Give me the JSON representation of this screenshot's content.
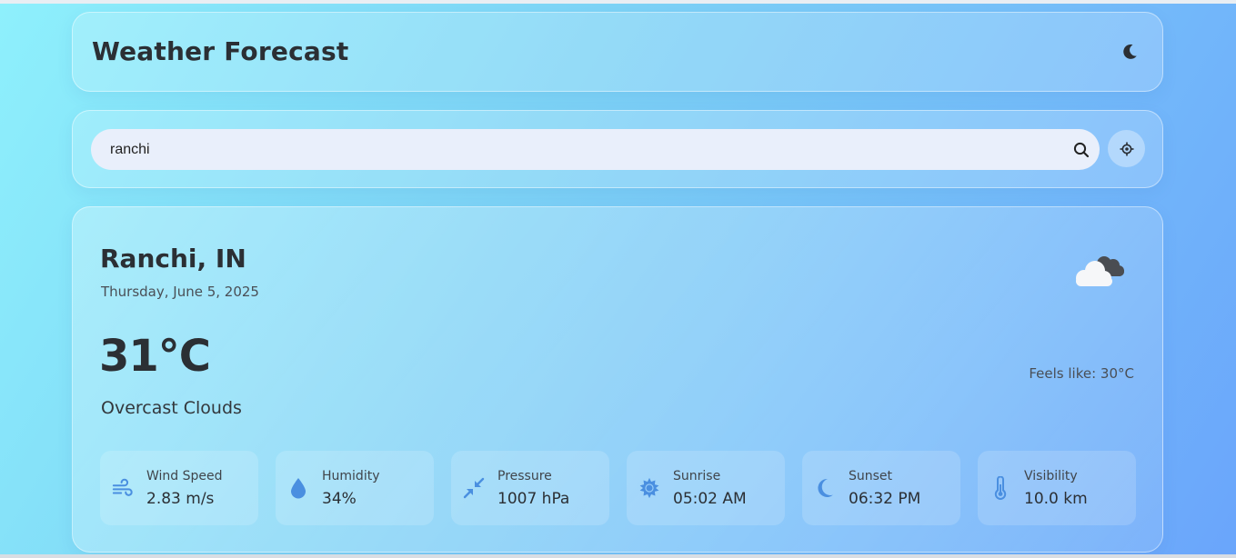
{
  "app": {
    "title": "Weather Forecast",
    "theme_toggle_icon": "moon-icon"
  },
  "search": {
    "value": "ranchi",
    "placeholder": "",
    "search_icon": "search-icon",
    "locate_icon": "location-crosshair-icon"
  },
  "weather": {
    "location": "Ranchi, IN",
    "date": "Thursday, June 5, 2025",
    "temperature": "31°C",
    "condition": "Overcast Clouds",
    "feels_like": "Feels like: 30°C",
    "condition_icon": "overcast-clouds-icon"
  },
  "stats": [
    {
      "label": "Wind Speed",
      "value": "2.83 m/s",
      "icon": "wind-icon"
    },
    {
      "label": "Humidity",
      "value": "34%",
      "icon": "droplet-icon"
    },
    {
      "label": "Pressure",
      "value": "1007 hPa",
      "icon": "compress-icon"
    },
    {
      "label": "Sunrise",
      "value": "05:02 AM",
      "icon": "sun-icon"
    },
    {
      "label": "Sunset",
      "value": "06:32 PM",
      "icon": "moon-icon"
    },
    {
      "label": "Visibility",
      "value": "10.0 km",
      "icon": "thermometer-icon"
    }
  ],
  "colors": {
    "icon_accent": "#4a8fe0",
    "text_dark": "#2b2f34"
  }
}
